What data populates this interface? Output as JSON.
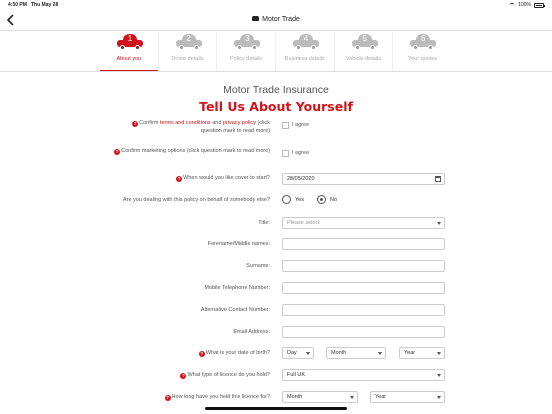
{
  "status": {
    "time": "4:50 PM",
    "date": "Thu May 28",
    "battery": "100%"
  },
  "nav": {
    "title": "Motor Trade",
    "back_icon": "chevron-left-icon"
  },
  "steps": [
    {
      "num": "1",
      "label": "About you",
      "active": true
    },
    {
      "num": "2",
      "label": "Driver details",
      "active": false
    },
    {
      "num": "3",
      "label": "Policy details",
      "active": false
    },
    {
      "num": "4",
      "label": "Business details",
      "active": false
    },
    {
      "num": "5",
      "label": "Vehicle details",
      "active": false
    },
    {
      "num": "6",
      "label": "Your quotes",
      "active": false
    }
  ],
  "form": {
    "heading": "Motor Trade Insurance",
    "subheading": "Tell Us About Yourself",
    "terms": {
      "pre": "Confirm ",
      "link1": "terms and conditions",
      "mid": " and ",
      "link2": "privacy policy",
      "post": " (click question mark to read more)",
      "checkbox_label": "I agree"
    },
    "marketing": {
      "label": "Confirm marketing options (click question mark to read more)",
      "checkbox_label": "I agree"
    },
    "cover_start": {
      "label": "When would you like cover to start?",
      "value": "28/05/2020"
    },
    "on_behalf": {
      "label": "Are you dealing with this policy on behalf of somebody else?",
      "yes": "Yes",
      "no": "No",
      "selected": "No"
    },
    "title": {
      "label": "Title:",
      "placeholder": "Please select"
    },
    "forename": {
      "label": "Forename/Middle names:",
      "value": ""
    },
    "surname": {
      "label": "Surname:",
      "value": ""
    },
    "mobile": {
      "label": "Mobile Telephone Number:",
      "value": ""
    },
    "alt_contact": {
      "label": "Alternative Contact Number:",
      "value": ""
    },
    "email": {
      "label": "Email Address:",
      "value": ""
    },
    "dob": {
      "label": "What is your date of birth?",
      "day": "Day",
      "month": "Month",
      "year": "Year"
    },
    "licence_type": {
      "label": "What type of licence do you hold?",
      "value": "Full UK"
    },
    "licence_held": {
      "label": "How long have you held this licence for?",
      "month": "Month",
      "year": "Year"
    },
    "help_glyph": "?"
  },
  "colors": {
    "accent": "#d3121a",
    "link": "#c0141b"
  }
}
